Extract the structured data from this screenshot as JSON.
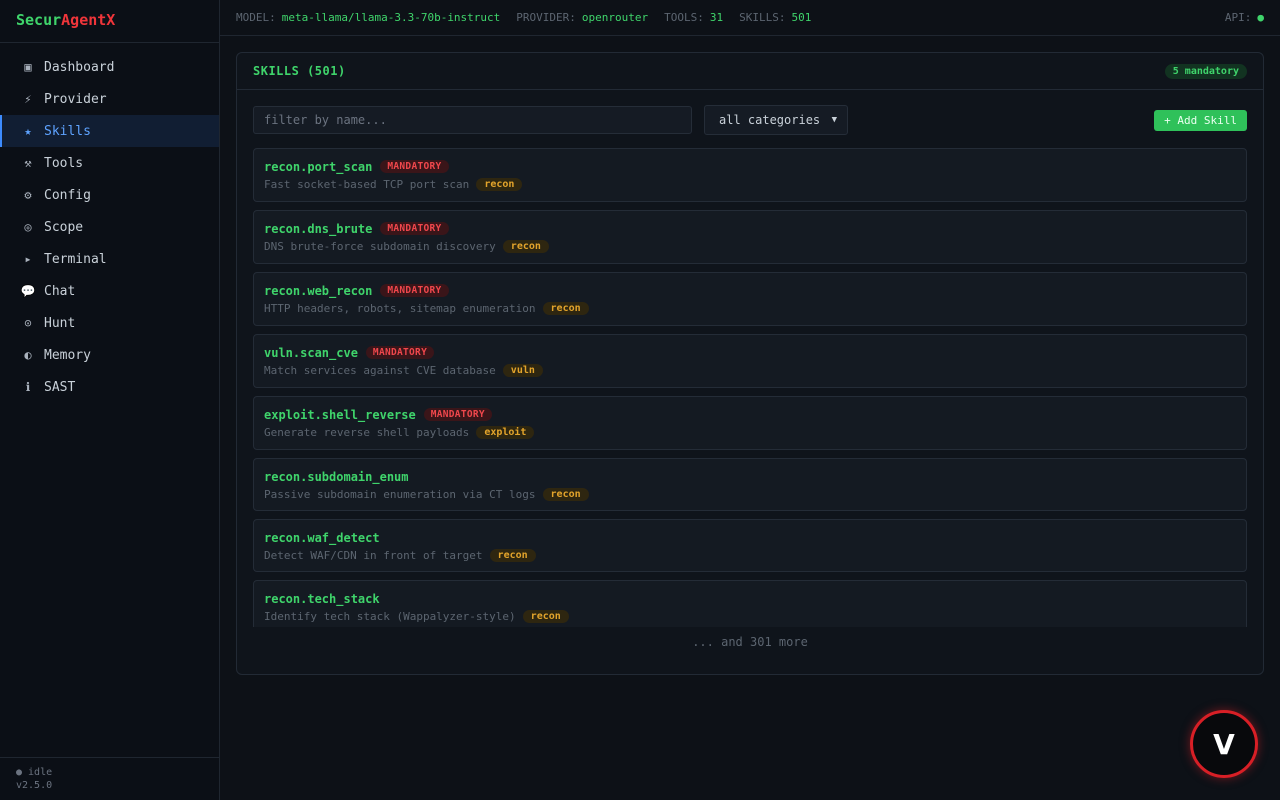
{
  "app": {
    "logo_part1": "Secur",
    "logo_part2": "AgentX",
    "status": "● idle",
    "version": "v2.5.0"
  },
  "sidebar": {
    "items": [
      {
        "label": "Dashboard",
        "icon": "▣"
      },
      {
        "label": "Provider",
        "icon": "⚡"
      },
      {
        "label": "Skills",
        "icon": "★"
      },
      {
        "label": "Tools",
        "icon": "⚒"
      },
      {
        "label": "Config",
        "icon": "⚙"
      },
      {
        "label": "Scope",
        "icon": "◎"
      },
      {
        "label": "Terminal",
        "icon": "▸"
      },
      {
        "label": "Chat",
        "icon": "💬"
      },
      {
        "label": "Hunt",
        "icon": "⊙"
      },
      {
        "label": "Memory",
        "icon": "◐"
      },
      {
        "label": "SAST",
        "icon": "ℹ"
      }
    ],
    "active": "Skills"
  },
  "topbar": {
    "model_label": "MODEL:",
    "model": "meta-llama/llama-3.3-70b-instruct",
    "provider_label": "PROVIDER:",
    "provider": "openrouter",
    "tools_label": "TOOLS:",
    "tools": "31",
    "skills_label": "SKILLS:",
    "skills": "501",
    "api_label": "API:",
    "api_status": "●"
  },
  "panel": {
    "title": "SKILLS (501)",
    "mandatory_count": "5 mandatory",
    "filter_placeholder": "filter by name...",
    "category_selected": "all categories",
    "add_button": "+ Add Skill",
    "more_text": "... and 301 more"
  },
  "skills": [
    {
      "name": "recon.port_scan",
      "mandatory": "MANDATORY",
      "desc": "Fast socket-based TCP port scan",
      "category": "recon"
    },
    {
      "name": "recon.dns_brute",
      "mandatory": "MANDATORY",
      "desc": "DNS brute-force subdomain discovery",
      "category": "recon"
    },
    {
      "name": "recon.web_recon",
      "mandatory": "MANDATORY",
      "desc": "HTTP headers, robots, sitemap enumeration",
      "category": "recon"
    },
    {
      "name": "vuln.scan_cve",
      "mandatory": "MANDATORY",
      "desc": "Match services against CVE database",
      "category": "vuln"
    },
    {
      "name": "exploit.shell_reverse",
      "mandatory": "MANDATORY",
      "desc": "Generate reverse shell payloads",
      "category": "exploit"
    },
    {
      "name": "recon.subdomain_enum",
      "mandatory": "",
      "desc": "Passive subdomain enumeration via CT logs",
      "category": "recon"
    },
    {
      "name": "recon.waf_detect",
      "mandatory": "",
      "desc": "Detect WAF/CDN in front of target",
      "category": "recon"
    },
    {
      "name": "recon.tech_stack",
      "mandatory": "",
      "desc": "Identify tech stack (Wappalyzer-style)",
      "category": "recon"
    }
  ],
  "fab": {
    "label": "V"
  },
  "colors": {
    "accent_green": "#3fd46b",
    "danger_red": "#f0474c",
    "category_amber": "#e3a42b",
    "active_blue": "#5ea3ff"
  }
}
